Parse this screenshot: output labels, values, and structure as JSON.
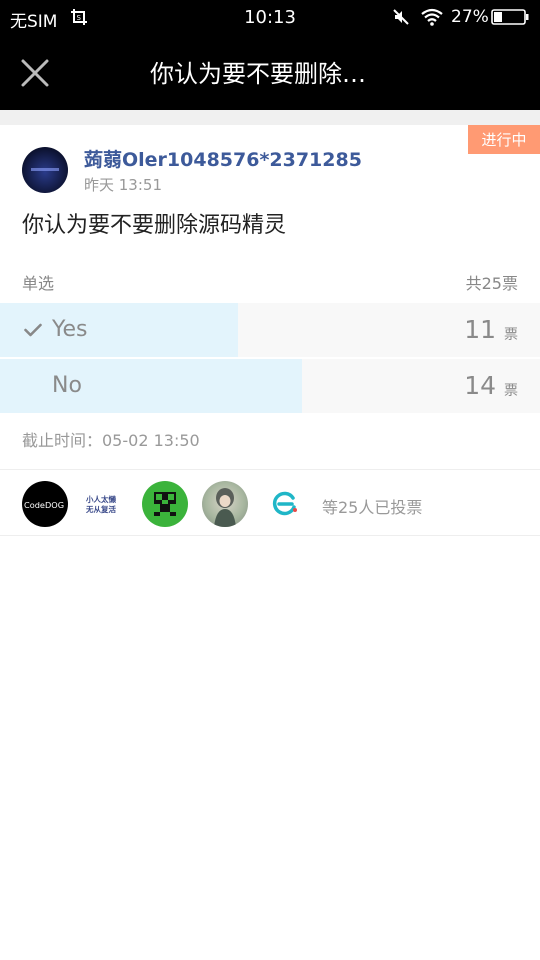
{
  "status_bar": {
    "carrier": "无SIM",
    "time": "10:13",
    "battery": "27%",
    "icons": [
      "crop-icon",
      "mute-icon",
      "wifi-icon",
      "battery-icon"
    ]
  },
  "titlebar": {
    "title": "你认为要不要删除…",
    "close_icon": "close-icon"
  },
  "poll": {
    "status": "进行中",
    "author": "蒟蒻Oler1048576*2371285",
    "time": "昨天 13:51",
    "question": "你认为要不要删除源码精灵",
    "type": "单选",
    "total": "共25票",
    "options": [
      {
        "label": "Yes",
        "count": "11",
        "unit": "票",
        "selected": true,
        "fraction": 0.44
      },
      {
        "label": "No",
        "count": "14",
        "unit": "票",
        "selected": false,
        "fraction": 0.56
      }
    ],
    "deadline": "截止时间：05-02 13:50",
    "voters_text": "等25人已投票",
    "voter_avatar_texts": [
      "CodeDOG",
      "小人太懒",
      "无从复活"
    ]
  },
  "colors": {
    "accent_tag": "#ff9a73",
    "author_name": "#3d5a9a",
    "bar_fill": "#e3f4fc",
    "bar_track": "#f8f8f8"
  }
}
